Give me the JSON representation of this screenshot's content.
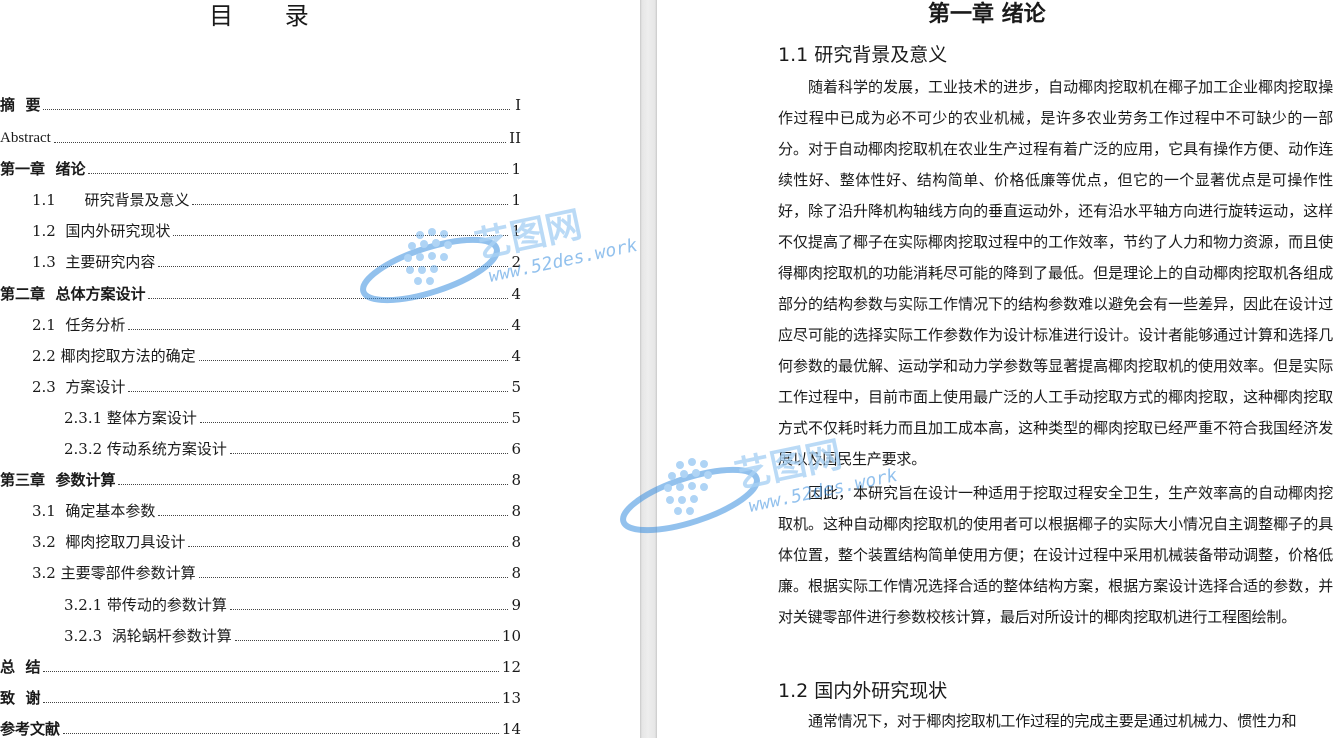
{
  "toc": {
    "title": "目 录",
    "entries": [
      {
        "label": "摘  要",
        "page": "I"
      },
      {
        "label": "Abstract",
        "page": "II"
      },
      {
        "label": "第一章  绪论",
        "page": "1"
      },
      {
        "label": "1.1      研究背景及意义",
        "page": "1"
      },
      {
        "label": "1.2  国内外研究现状",
        "page": "1"
      },
      {
        "label": "1.3  主要研究内容",
        "page": "2"
      },
      {
        "label": "第二章  总体方案设计",
        "page": "4"
      },
      {
        "label": "2.1  任务分析",
        "page": "4"
      },
      {
        "label": "2.2 椰肉挖取方法的确定",
        "page": "4"
      },
      {
        "label": "2.3  方案设计",
        "page": "5"
      },
      {
        "label": "2.3.1 整体方案设计",
        "page": "5"
      },
      {
        "label": "2.3.2 传动系统方案设计",
        "page": "6"
      },
      {
        "label": "第三章  参数计算",
        "page": "8"
      },
      {
        "label": "3.1  确定基本参数",
        "page": "8"
      },
      {
        "label": "3.2  椰肉挖取刀具设计",
        "page": "8"
      },
      {
        "label": "3.2 主要零部件参数计算",
        "page": "8"
      },
      {
        "label": "3.2.1 带传动的参数计算",
        "page": "9"
      },
      {
        "label": "3.2.3  涡轮蜗杆参数计算",
        "page": "10"
      },
      {
        "label": "总  结",
        "page": "12"
      },
      {
        "label": "致  谢",
        "page": "13"
      },
      {
        "label": "参考文献",
        "page": "14"
      }
    ]
  },
  "chapter": {
    "title": "第一章  绪论",
    "section1_heading": "1.1  研究背景及意义",
    "section1_para1": "随着科学的发展，工业技术的进步，自动椰肉挖取机在椰子加工企业椰肉挖取操作过程中已成为必不可少的农业机械，是许多农业劳务工作过程中不可缺少的一部分。对于自动椰肉挖取机在农业生产过程有着广泛的应用，它具有操作方便、动作连续性好、整体性好、结构简单、价格低廉等优点，但它的一个显著优点是可操作性好，除了沿升降机构轴线方向的垂直运动外，还有沿水平轴方向进行旋转运动，这样不仅提高了椰子在实际椰肉挖取过程中的工作效率，节约了人力和物力资源，而且使得椰肉挖取机的功能消耗尽可能的降到了最低。但是理论上的自动椰肉挖取机各组成部分的结构参数与实际工作情况下的结构参数难以避免会有一些差异，因此在设计过应尽可能的选择实际工作参数作为设计标准进行设计。设计者能够通过计算和选择几何参数的最优解、运动学和动力学参数等显著提高椰肉挖取机的使用效率。但是实际工作过程中，目前市面上使用最广泛的人工手动挖取方式的椰肉挖取，这种椰肉挖取方式不仅耗时耗力而且加工成本高，这种类型的椰肉挖取已经严重不符合我国经济发展以及国民生产要求。",
    "section1_para2": "因此，本研究旨在设计一种适用于挖取过程安全卫生，生产效率高的自动椰肉挖取机。这种自动椰肉挖取机的使用者可以根据椰子的实际大小情况自主调整椰子的具体位置，整个装置结构简单使用方便；在设计过程中采用机械装备带动调整，价格低廉。根据实际工作情况选择合适的整体结构方案，根据方案设计选择合适的参数，并对关键零部件进行参数校核计算，最后对所设计的椰肉挖取机进行工程图绘制。",
    "section2_heading": "1.2  国内外研究现状",
    "section2_para1": "通常情况下，对于椰肉挖取机工作过程的完成主要是通过机械力、惯性力和"
  },
  "watermark": {
    "brand": "艺图网",
    "url": "www.52des.work",
    "colors": {
      "blue": "#3a8fe0",
      "light": "#a9d2f5"
    }
  }
}
